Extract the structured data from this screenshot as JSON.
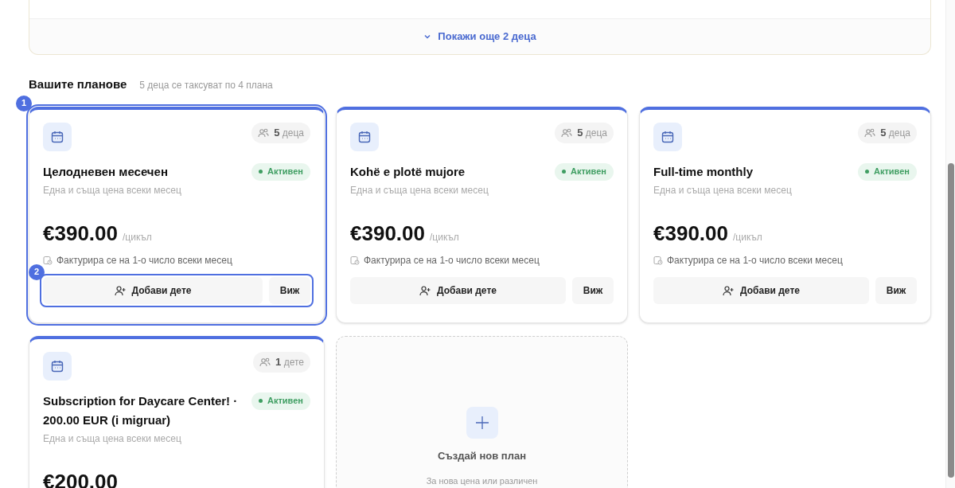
{
  "children_panel": {
    "show_more": "Покажи още 2 деца"
  },
  "plans_section": {
    "title": "Вашите планове",
    "subtitle": "5 деца се таксуват по 4 плана"
  },
  "plans": [
    {
      "kind": "plan",
      "annotation": "1",
      "actions_annotation": "2",
      "children": "5",
      "children_unit": "деца",
      "name": "Целодневен месечен",
      "status": "Активен",
      "description": "Една и съща цена всеки месец",
      "price": "€390.00",
      "period": "/цикъл",
      "billing": "Фактурира се на 1-о число всеки месец",
      "add_button": "Добави дете",
      "view_button": "Виж"
    },
    {
      "kind": "plan",
      "children": "5",
      "children_unit": "деца",
      "name": "Kohë e plotë mujore",
      "status": "Активен",
      "description": "Една и съща цена всеки месец",
      "price": "€390.00",
      "period": "/цикъл",
      "billing": "Фактурира се на 1-о число всеки месец",
      "add_button": "Добави дете",
      "view_button": "Виж"
    },
    {
      "kind": "plan",
      "children": "5",
      "children_unit": "деца",
      "name": "Full-time monthly",
      "status": "Активен",
      "description": "Една и съща цена всеки месец",
      "price": "€390.00",
      "period": "/цикъл",
      "billing": "Фактурира се на 1-о число всеки месец",
      "add_button": "Добави дете",
      "view_button": "Виж"
    },
    {
      "kind": "plan",
      "children": "1",
      "children_unit": "дете",
      "name": "Subscription for Daycare Center! · 200.00 EUR (i migruar)",
      "status": "Активен",
      "description": "Една и съща цена всеки месец",
      "price": "€200.00"
    },
    {
      "kind": "create",
      "title": "Създай нов план",
      "subtitle": "За нова цена или различен"
    }
  ]
}
